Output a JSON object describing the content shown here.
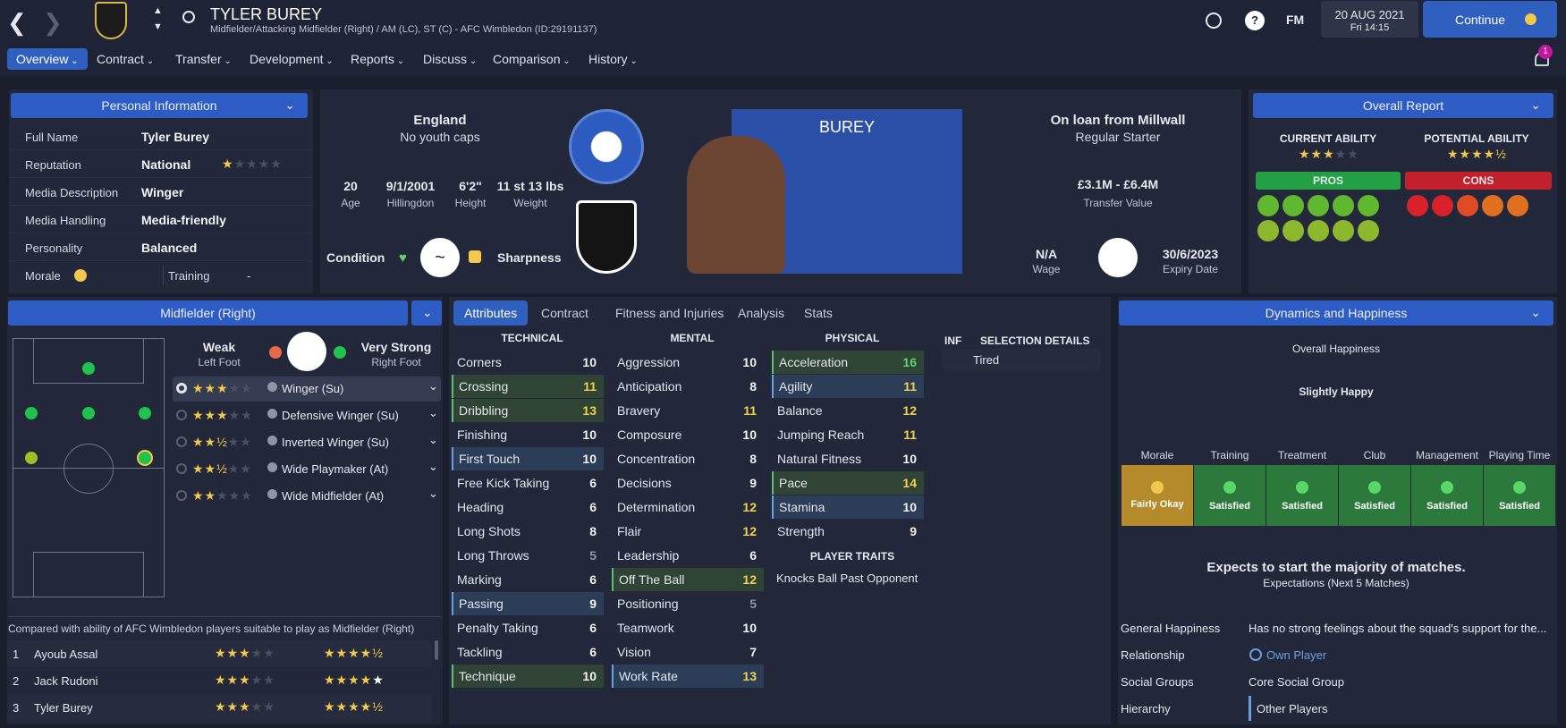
{
  "header": {
    "name": "TYLER BUREY",
    "subtitle": "Midfielder/Attacking Midfielder (Right) / AM (LC), ST (C) - AFC Wimbledon (ID:29191137)",
    "date": "20 AUG 2021",
    "time": "Fri 14:15",
    "continue": "Continue",
    "fm": "FM",
    "notif": "1"
  },
  "nav": [
    "Overview",
    "Contract",
    "Transfer",
    "Development",
    "Reports",
    "Discuss",
    "Comparison",
    "History"
  ],
  "personal": {
    "title": "Personal Information",
    "rows": [
      {
        "label": "Full Name",
        "value": "Tyler Burey"
      },
      {
        "label": "Reputation",
        "value": "National"
      },
      {
        "label": "Media Description",
        "value": "Winger"
      },
      {
        "label": "Media Handling",
        "value": "Media-friendly"
      },
      {
        "label": "Personality",
        "value": "Balanced"
      }
    ],
    "morale": "Morale",
    "training": "Training",
    "training_val": "-"
  },
  "bio": {
    "nation": "England",
    "caps": "No youth caps",
    "age": "20",
    "age_l": "Age",
    "dob": "9/1/2001",
    "dob_l": "Hillingdon",
    "height": "6'2\"",
    "height_l": "Height",
    "weight": "11 st 13 lbs",
    "weight_l": "Weight",
    "condition": "Condition",
    "sharpness": "Sharpness",
    "shirt_name": "BUREY",
    "loan": "On loan from Millwall",
    "status": "Regular Starter",
    "value": "£3.1M - £6.4M",
    "value_l": "Transfer Value",
    "wage": "N/A",
    "wage_l": "Wage",
    "expiry": "30/6/2023",
    "expiry_l": "Expiry Date"
  },
  "report": {
    "title": "Overall Report",
    "ca": "CURRENT ABILITY",
    "pa": "POTENTIAL ABILITY",
    "ca_stars": 3,
    "pa_stars": 4.5,
    "pros": "PROS",
    "cons": "CONS"
  },
  "position": {
    "title": "Midfielder (Right)",
    "weak": "Weak",
    "weak_l": "Left Foot",
    "strong": "Very Strong",
    "strong_l": "Right Foot",
    "roles": [
      {
        "name": "Winger (Su)",
        "stars": 3
      },
      {
        "name": "Defensive Winger (Su)",
        "stars": 3
      },
      {
        "name": "Inverted Winger (Su)",
        "stars": 2.5
      },
      {
        "name": "Wide Playmaker (At)",
        "stars": 2.5
      },
      {
        "name": "Wide Midfielder (At)",
        "stars": 2
      }
    ],
    "compare": "Compared with ability of AFC Wimbledon players suitable to play as Midfielder (Right)",
    "players": [
      {
        "n": "1",
        "name": "Ayoub Assal",
        "ca": 3,
        "pa": 4.5
      },
      {
        "n": "2",
        "name": "Jack Rudoni",
        "ca": 3,
        "pa": 5
      },
      {
        "n": "3",
        "name": "Tyler Burey",
        "ca": 3,
        "pa": 4.5
      }
    ]
  },
  "tabs": [
    "Attributes",
    "Contract",
    "Fitness and Injuries",
    "Analysis",
    "Stats"
  ],
  "attributes": {
    "technical_title": "TECHNICAL",
    "mental_title": "MENTAL",
    "physical_title": "PHYSICAL",
    "technical": [
      [
        "Corners",
        "10"
      ],
      [
        "Crossing",
        "11"
      ],
      [
        "Dribbling",
        "13"
      ],
      [
        "Finishing",
        "10"
      ],
      [
        "First Touch",
        "10"
      ],
      [
        "Free Kick Taking",
        "6"
      ],
      [
        "Heading",
        "6"
      ],
      [
        "Long Shots",
        "8"
      ],
      [
        "Long Throws",
        "5"
      ],
      [
        "Marking",
        "6"
      ],
      [
        "Passing",
        "9"
      ],
      [
        "Penalty Taking",
        "6"
      ],
      [
        "Tackling",
        "6"
      ],
      [
        "Technique",
        "10"
      ]
    ],
    "mental": [
      [
        "Aggression",
        "10"
      ],
      [
        "Anticipation",
        "8"
      ],
      [
        "Bravery",
        "11"
      ],
      [
        "Composure",
        "10"
      ],
      [
        "Concentration",
        "8"
      ],
      [
        "Decisions",
        "9"
      ],
      [
        "Determination",
        "12"
      ],
      [
        "Flair",
        "12"
      ],
      [
        "Leadership",
        "6"
      ],
      [
        "Off The Ball",
        "12"
      ],
      [
        "Positioning",
        "5"
      ],
      [
        "Teamwork",
        "10"
      ],
      [
        "Vision",
        "7"
      ],
      [
        "Work Rate",
        "13"
      ]
    ],
    "physical": [
      [
        "Acceleration",
        "16"
      ],
      [
        "Agility",
        "11"
      ],
      [
        "Balance",
        "12"
      ],
      [
        "Jumping Reach",
        "11"
      ],
      [
        "Natural Fitness",
        "10"
      ],
      [
        "Pace",
        "14"
      ],
      [
        "Stamina",
        "10"
      ],
      [
        "Strength",
        "9"
      ]
    ],
    "traits_title": "PLAYER TRAITS",
    "traits": "Knocks Ball Past Opponent",
    "inf": "INF",
    "sel": "SELECTION DETAILS",
    "sel_val": "Tired"
  },
  "dynamics": {
    "title": "Dynamics and Happiness",
    "overall": "Overall Happiness",
    "level": "Slightly Happy",
    "cats": [
      {
        "h": "Morale",
        "v": "Fairly Okay"
      },
      {
        "h": "Training",
        "v": "Satisfied"
      },
      {
        "h": "Treatment",
        "v": "Satisfied"
      },
      {
        "h": "Club",
        "v": "Satisfied"
      },
      {
        "h": "Management",
        "v": "Satisfied"
      },
      {
        "h": "Playing Time",
        "v": "Satisfied"
      }
    ],
    "expect": "Expects to start the majority of matches.",
    "expect_sub": "Expectations (Next 5 Matches)",
    "rows": [
      {
        "l": "General Happiness",
        "v": "Has no strong feelings about the squad's support for the..."
      },
      {
        "l": "Relationship",
        "v": "Own Player"
      },
      {
        "l": "Social Groups",
        "v": "Core Social Group"
      },
      {
        "l": "Hierarchy",
        "v": "Other Players"
      }
    ]
  }
}
